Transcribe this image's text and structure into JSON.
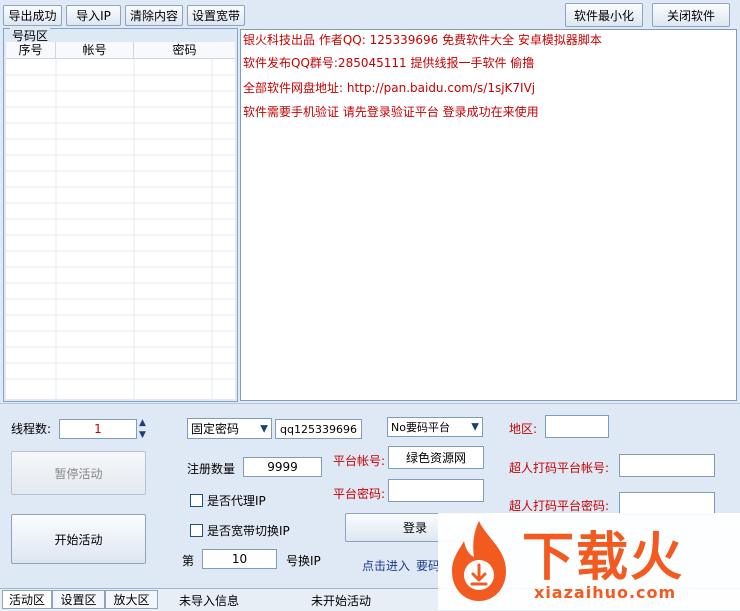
{
  "toolbar": {
    "export_success": "导出成功",
    "import_ip": "导入IP",
    "clear_content": "清除内容",
    "set_broadband": "设置宽带",
    "minimize": "软件最小化",
    "close": "关闭软件"
  },
  "number_area": {
    "title": "号码区",
    "columns": [
      "序号",
      "帐号",
      "密码"
    ]
  },
  "log": {
    "lines": [
      "银火科技出品  作者QQ: 125339696 免费软件大全 安卓模拟器脚本",
      "软件发布QQ群号:285045111  提供线报一手软件 偷撸",
      "全部软件网盘地址: http://pan.baidu.com/s/1sjK7IVj",
      "软件需要手机验证 请先登录验证平台 登录成功在来使用"
    ]
  },
  "controls": {
    "threads_label": "线程数:",
    "threads_value": "1",
    "pause_label": "暂停活动",
    "start_label": "开始活动",
    "password_mode": "固定密码",
    "password_value": "qq125339696",
    "register_count_label": "注册数量",
    "register_count_value": "9999",
    "use_proxy_label": "是否代理IP",
    "broadband_switch_label": "是否宽带切换IP",
    "switch_prefix": "第",
    "switch_value": "10",
    "switch_suffix": "号换IP",
    "platform_select": "No要码平台",
    "platform_account_label": "平台帐号:",
    "platform_account_value": "绿色资源网",
    "platform_password_label": "平台密码:",
    "platform_password_value": "",
    "login_label": "登录",
    "click_enter_label": "点击进入",
    "code_label": "要码",
    "region_label": "地区:",
    "region_value": "",
    "captcha_account_label": "超人打码平台帐号:",
    "captcha_account_value": "",
    "captcha_password_label": "超人打码平台密码:",
    "captcha_password_value": ""
  },
  "status": {
    "tabs": [
      "活动区",
      "设置区",
      "放大区"
    ],
    "import_info": "未导入信息",
    "activity_status": "未开始活动"
  },
  "watermark": {
    "brand": "下载火",
    "site": "xiazaihuo.com"
  },
  "colors": {
    "log_text": "#c80000",
    "threads_text": "#c80000",
    "accent_border": "#7f9db9",
    "watermark_orange": "#f25a1f"
  }
}
